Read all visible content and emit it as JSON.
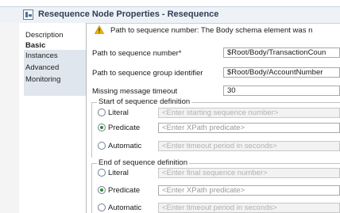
{
  "title": "Resequence Node Properties - Resequence",
  "nav": {
    "items": [
      {
        "label": "Description"
      },
      {
        "label": "Basic"
      },
      {
        "label": "Instances"
      },
      {
        "label": "Advanced"
      },
      {
        "label": "Monitoring"
      }
    ],
    "selected": "Basic"
  },
  "warning": {
    "icon": "warning-icon",
    "color": "#f0b400",
    "text": "Path to sequence number: The Body schema element was n"
  },
  "form": {
    "path_seq_number": {
      "label": "Path to sequence number*",
      "value": "$Root/Body/TransactionCoun"
    },
    "path_seq_group": {
      "label": "Path to sequence group identifier",
      "value": "$Root/Body/AccountNumber"
    },
    "missing_timeout": {
      "label": "Missing message timeout",
      "value": "30"
    }
  },
  "start_group": {
    "title": "Start of sequence definition",
    "options": [
      {
        "label": "Literal",
        "placeholder": "<Enter starting sequence number>",
        "selected": false
      },
      {
        "label": "Predicate",
        "placeholder": "<Enter XPath predicate>",
        "selected": true
      },
      {
        "label": "Automatic",
        "placeholder": "<Enter timeout period in seconds>",
        "selected": false
      }
    ]
  },
  "end_group": {
    "title": "End of sequence definition",
    "options": [
      {
        "label": "Literal",
        "placeholder": "<Enter final sequence number>",
        "selected": false
      },
      {
        "label": "Predicate",
        "placeholder": "<Enter XPath predicate>",
        "selected": true
      },
      {
        "label": "Automatic",
        "placeholder": "<Enter timeout period in seconds>",
        "selected": false
      }
    ]
  }
}
